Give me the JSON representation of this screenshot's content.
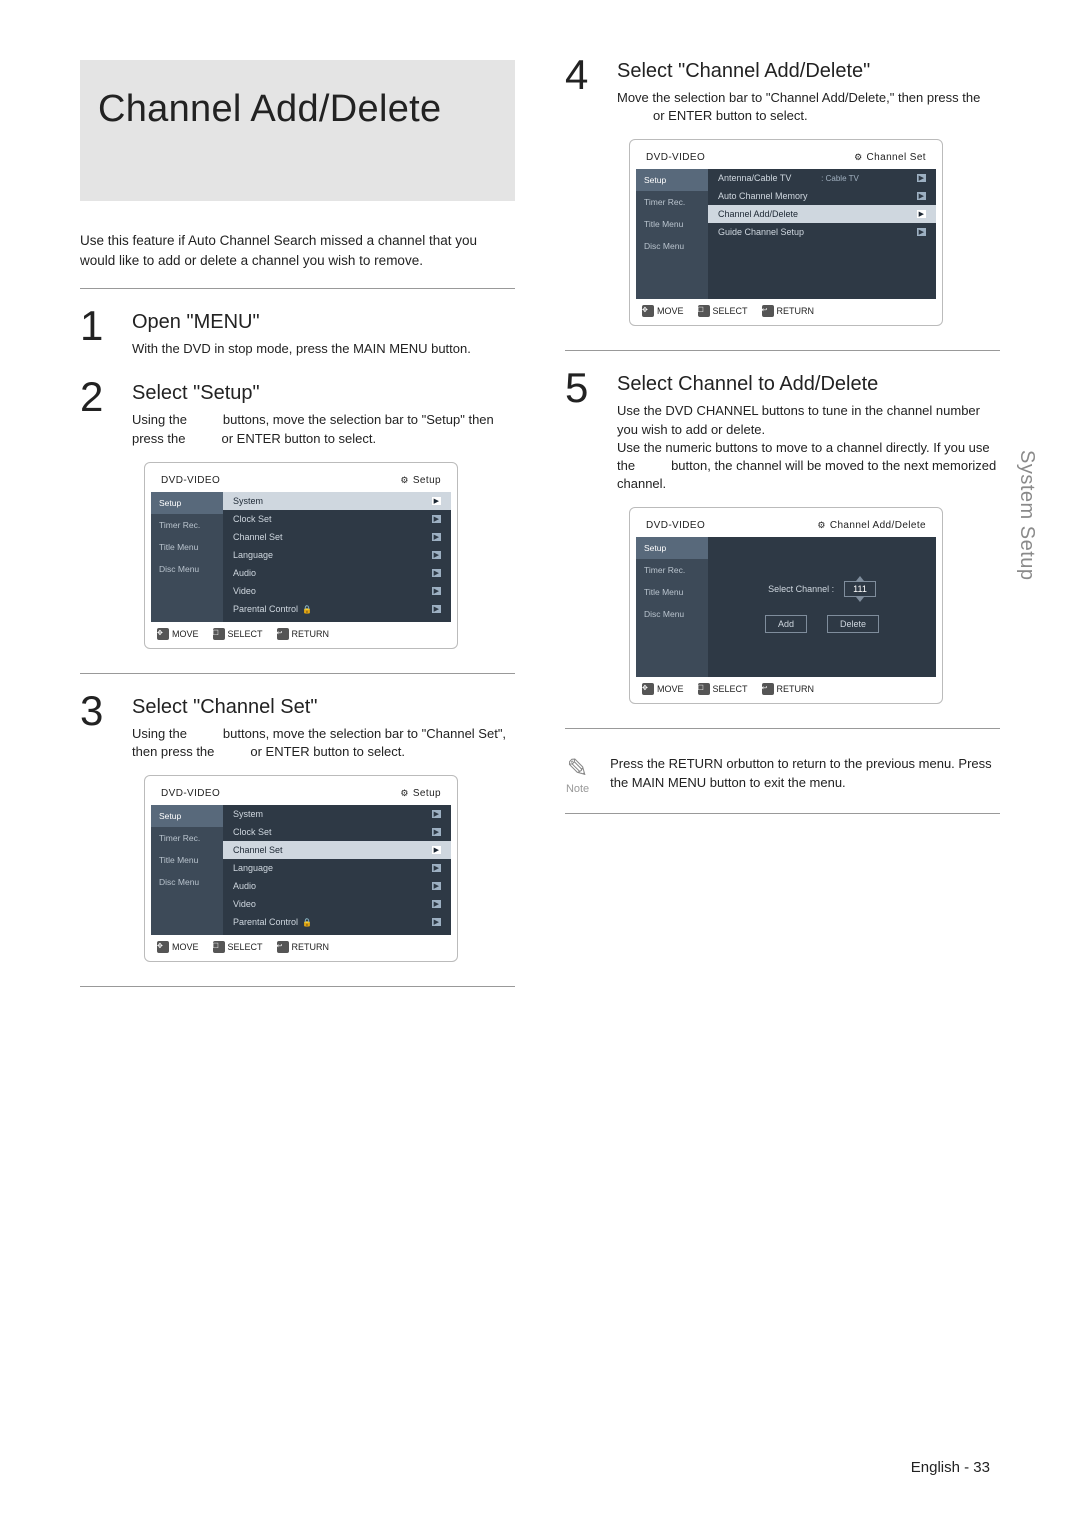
{
  "page": {
    "title": "Channel Add/Delete",
    "intro": "Use this feature if Auto Channel Search missed a channel that you would like to add or delete a channel you wish to remove.",
    "side_tab": "System Setup",
    "footer": "English - 33"
  },
  "steps": {
    "s1": {
      "num": "1",
      "title": "Open \"MENU\"",
      "desc": "With the DVD in stop mode, press the MAIN MENU button."
    },
    "s2": {
      "num": "2",
      "title": "Select \"Setup\"",
      "desc_a": "Using the",
      "desc_b": "buttons, move the selection bar to \"Setup\" then press the",
      "desc_c": "or ENTER button to select."
    },
    "s3": {
      "num": "3",
      "title": "Select \"Channel Set\"",
      "desc_a": "Using the",
      "desc_b": "buttons, move the selection bar to \"Channel Set\", then press the",
      "desc_c": "or ENTER button to select."
    },
    "s4": {
      "num": "4",
      "title": "Select \"Channel Add/Delete\"",
      "desc_a": "Move the selection bar to \"Channel Add/Delete,\" then press the",
      "desc_b": "or ENTER button to select."
    },
    "s5": {
      "num": "5",
      "title": "Select Channel to Add/Delete",
      "desc_a": "Use the DVD CHANNEL buttons to tune in the channel number you wish to add or delete.",
      "desc_b": "Use the numeric buttons to move to a channel directly. If you use the",
      "desc_c": "button, the channel will be moved to the next memorized channel."
    }
  },
  "osd_common": {
    "device": "DVD-VIDEO",
    "sidebar": [
      "Setup",
      "Timer Rec.",
      "Title Menu",
      "Disc Menu"
    ],
    "foot_move": "MOVE",
    "foot_select": "SELECT",
    "foot_return": "RETURN"
  },
  "osd_setup_crumb": "Setup",
  "osd_setup_items": {
    "i0": "System",
    "i1": "Clock Set",
    "i2": "Channel Set",
    "i3": "Language",
    "i4": "Audio",
    "i5": "Video",
    "i6": "Parental Control"
  },
  "osd_chset": {
    "crumb": "Channel Set",
    "i0": "Antenna/Cable TV",
    "i0v": ": Cable TV",
    "i1": "Auto Channel Memory",
    "i2": "Channel Add/Delete",
    "i3": "Guide Channel Setup"
  },
  "osd_chadd": {
    "crumb": "Channel Add/Delete",
    "label": "Select Channel :",
    "value": "111",
    "add": "Add",
    "delete": "Delete"
  },
  "note": {
    "label": "Note",
    "text_a": "Press the RETURN or",
    "text_b": "button to return to the previous menu. Press the MAIN MENU button to exit the menu."
  }
}
